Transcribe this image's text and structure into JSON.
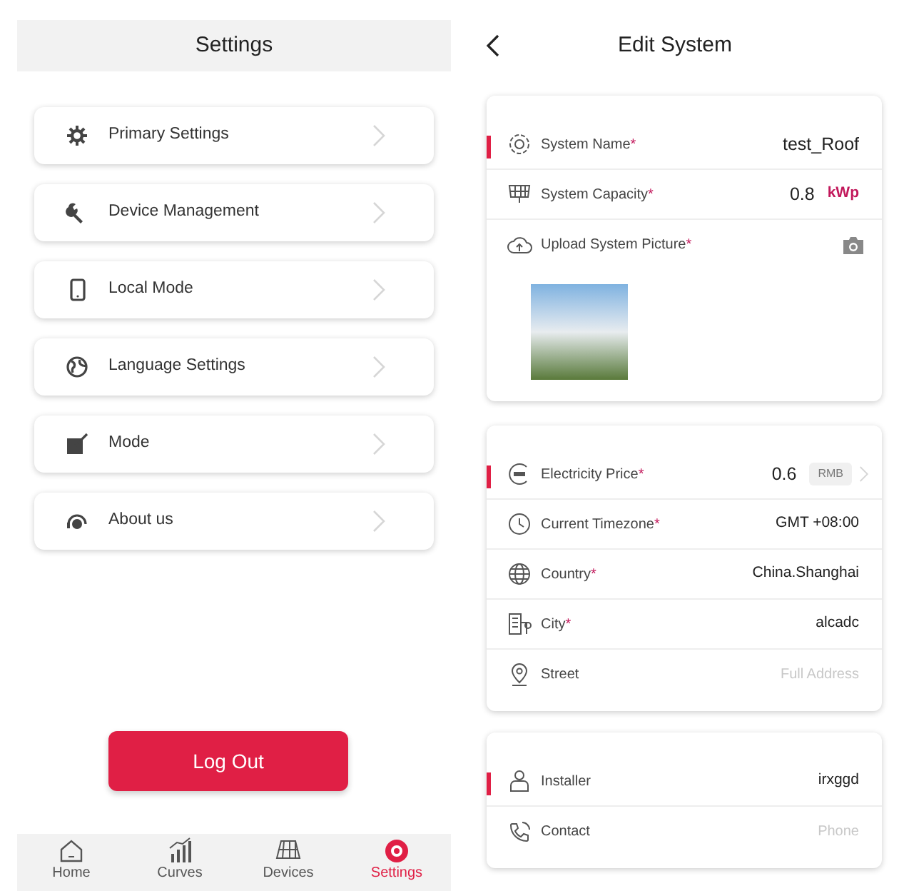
{
  "settings_screen": {
    "title": "Settings",
    "menu_items": [
      {
        "label": "Primary Settings"
      },
      {
        "label": "Device Management"
      },
      {
        "label": "Local Mode"
      },
      {
        "label": "Language Settings"
      },
      {
        "label": "Mode"
      },
      {
        "label": "About us"
      }
    ],
    "logout_button": "Log Out",
    "nav_tabs": [
      {
        "label": "Home",
        "selected": false
      },
      {
        "label": "Curves",
        "selected": false
      },
      {
        "label": "Devices",
        "selected": false
      },
      {
        "label": "Settings",
        "selected": true
      }
    ]
  },
  "edit_system_screen": {
    "title": "Edit System",
    "cards": [
      {
        "rows": [
          {
            "kind": "text",
            "label": "System Name",
            "required_mark": "*",
            "highlighted": true,
            "value": "test_Roof"
          },
          {
            "kind": "unit",
            "label": "System Capacity",
            "required_mark": "*",
            "highlighted": false,
            "value": "0.8",
            "unit": "kWp"
          },
          {
            "kind": "photo",
            "label": "Upload System Picture",
            "required_mark": "*",
            "highlighted": false
          }
        ]
      },
      {
        "rows": [
          {
            "kind": "price",
            "label": "Electricity Price",
            "required_mark": "*",
            "highlighted": true,
            "value": "0.6",
            "unit": "RMB"
          },
          {
            "kind": "text",
            "label": "Current Timezone",
            "required_mark": "*",
            "highlighted": false,
            "value": "GMT +08:00"
          },
          {
            "kind": "text",
            "label": "Country",
            "required_mark": "*",
            "highlighted": false,
            "value": "China.Shanghai"
          },
          {
            "kind": "text",
            "label": "City",
            "required_mark": "*",
            "highlighted": false,
            "value": "alcadc"
          },
          {
            "kind": "text",
            "label": "Street",
            "highlighted": false,
            "placeholder": "Full Address"
          }
        ]
      },
      {
        "rows": [
          {
            "kind": "text",
            "label": "Installer",
            "highlighted": true,
            "value": "irxggd"
          },
          {
            "kind": "text",
            "label": "Contact",
            "highlighted": false,
            "placeholder": "Phone"
          }
        ]
      }
    ]
  }
}
